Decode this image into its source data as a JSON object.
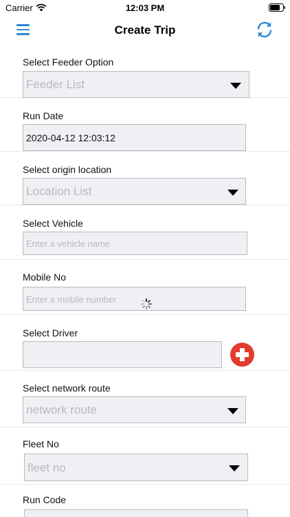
{
  "status_bar": {
    "carrier": "Carrier",
    "time": "12:03 PM"
  },
  "nav": {
    "title": "Create Trip",
    "menu_icon": "hamburger-menu-icon",
    "refresh_icon": "refresh-icon"
  },
  "form": {
    "feeder": {
      "label": "Select Feeder Option",
      "placeholder": "Feeder List"
    },
    "run_date": {
      "label": "Run Date",
      "value": "2020-04-12 12:03:12"
    },
    "origin": {
      "label": "Select origin location",
      "placeholder": "Location List"
    },
    "vehicle": {
      "label": "Select Vehicle",
      "placeholder": "Enter a vehicle name"
    },
    "mobile": {
      "label": "Mobile No",
      "placeholder": "Enter a mobile number"
    },
    "driver": {
      "label": "Select Driver",
      "value": ""
    },
    "network_route": {
      "label": "Select network route",
      "placeholder": "network route"
    },
    "fleet": {
      "label": "Fleet No",
      "placeholder": "fleet no"
    },
    "run_code": {
      "label": "Run Code"
    }
  },
  "colors": {
    "accent": "#2f86d6",
    "add_button": "#e23b2e",
    "field_bg": "#efeff4"
  }
}
